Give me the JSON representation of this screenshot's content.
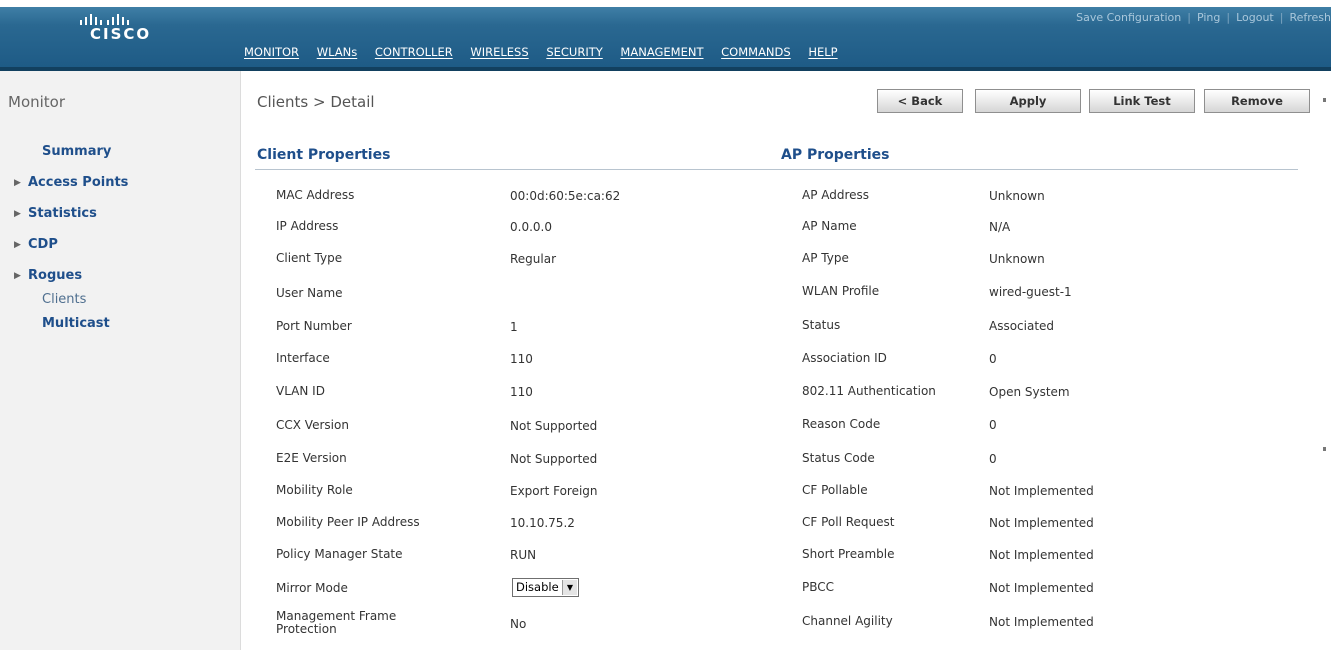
{
  "header": {
    "logo_text": "CISCO",
    "top_links": [
      "Save Configuration",
      "Ping",
      "Logout",
      "Refresh"
    ],
    "nav": [
      "MONITOR",
      "WLANs",
      "CONTROLLER",
      "WIRELESS",
      "SECURITY",
      "MANAGEMENT",
      "COMMANDS",
      "HELP"
    ]
  },
  "sidebar": {
    "title": "Monitor",
    "items": [
      {
        "label": "Summary",
        "arrow": false
      },
      {
        "label": "Access Points",
        "arrow": true
      },
      {
        "label": "Statistics",
        "arrow": true
      },
      {
        "label": "CDP",
        "arrow": true
      },
      {
        "label": "Rogues",
        "arrow": true
      },
      {
        "label": "Clients",
        "arrow": false
      },
      {
        "label": "Multicast",
        "arrow": false
      }
    ]
  },
  "main": {
    "breadcrumb": "Clients > Detail",
    "buttons": {
      "back": "< Back",
      "apply": "Apply",
      "link_test": "Link Test",
      "remove": "Remove"
    },
    "client_title": "Client Properties",
    "ap_title": "AP Properties",
    "client_rows": [
      {
        "label": "MAC Address",
        "value": "00:0d:60:5e:ca:62"
      },
      {
        "label": "IP Address",
        "value": "0.0.0.0"
      },
      {
        "label": "Client Type",
        "value": "Regular"
      },
      {
        "label": "User Name",
        "value": ""
      },
      {
        "label": "Port Number",
        "value": "1"
      },
      {
        "label": "Interface",
        "value": "110"
      },
      {
        "label": "VLAN ID",
        "value": "110"
      },
      {
        "label": "CCX Version",
        "value": "Not Supported"
      },
      {
        "label": "E2E Version",
        "value": "Not Supported"
      },
      {
        "label": "Mobility Role",
        "value": "Export Foreign"
      },
      {
        "label": "Mobility Peer IP Address",
        "value": "10.10.75.2"
      },
      {
        "label": "Policy Manager State",
        "value": "RUN"
      },
      {
        "label": "Mirror Mode",
        "value": "Disable"
      },
      {
        "label": "Management Frame Protection",
        "value": "No"
      }
    ],
    "ap_rows": [
      {
        "label": "AP Address",
        "value": "Unknown"
      },
      {
        "label": "AP Name",
        "value": "N/A"
      },
      {
        "label": "AP Type",
        "value": "Unknown"
      },
      {
        "label": "WLAN Profile",
        "value": "wired-guest-1"
      },
      {
        "label": "Status",
        "value": "Associated"
      },
      {
        "label": "Association ID",
        "value": "0"
      },
      {
        "label": "802.11 Authentication",
        "value": "Open System"
      },
      {
        "label": "Reason Code",
        "value": "0"
      },
      {
        "label": "Status Code",
        "value": "0"
      },
      {
        "label": "CF Pollable",
        "value": "Not Implemented"
      },
      {
        "label": "CF Poll Request",
        "value": "Not Implemented"
      },
      {
        "label": "Short Preamble",
        "value": "Not Implemented"
      },
      {
        "label": "PBCC",
        "value": "Not Implemented"
      },
      {
        "label": "Channel Agility",
        "value": "Not Implemented"
      }
    ]
  }
}
